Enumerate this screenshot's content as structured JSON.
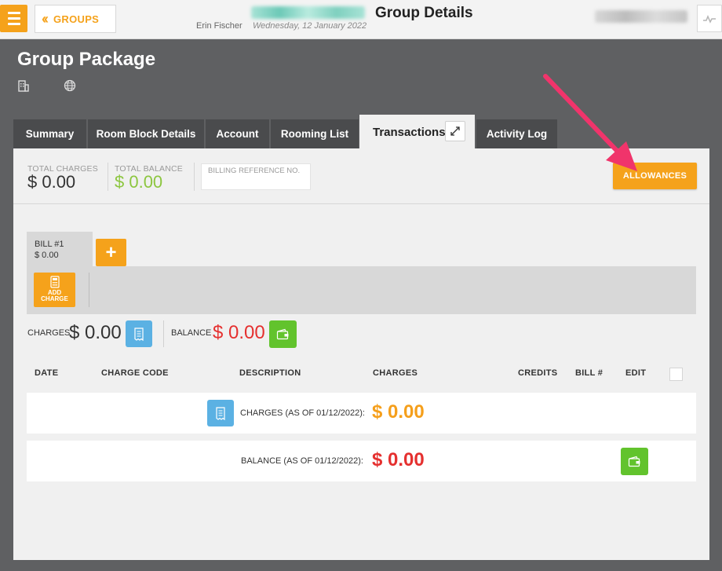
{
  "topbar": {
    "menu_icon": "hamburger-icon",
    "back_label": "GROUPS",
    "page_title": "Group Details",
    "user_name": "Erin Fischer",
    "date": "Wednesday, 12 January 2022",
    "activity_icon": "pulse-icon"
  },
  "header": {
    "title": "Group Package",
    "icons": [
      "building-icon",
      "globe-icon"
    ]
  },
  "tabs": [
    {
      "label": "Summary"
    },
    {
      "label": "Room Block Details"
    },
    {
      "label": "Account"
    },
    {
      "label": "Rooming List"
    },
    {
      "label": "Transactions",
      "active": true
    },
    {
      "label": "Activity Log"
    }
  ],
  "summary": {
    "total_charges_label": "TOTAL CHARGES",
    "total_charges_value": "$ 0.00",
    "total_balance_label": "TOTAL BALANCE",
    "total_balance_value": "$ 0.00",
    "billing_ref_placeholder": "BILLING REFERENCE NO.",
    "allowances_label": "ALLOWANCES"
  },
  "bill": {
    "name": "BILL #1",
    "amount": "$ 0.00",
    "add_bill_label": "+",
    "add_charge_label_1": "ADD",
    "add_charge_label_2": "CHARGE"
  },
  "totals": {
    "charges_label": "CHARGES",
    "charges_value": "$ 0.00",
    "balance_label": "BALANCE",
    "balance_value": "$ 0.00"
  },
  "table": {
    "headers": [
      "DATE",
      "CHARGE CODE",
      "DESCRIPTION",
      "CHARGES",
      "CREDITS",
      "BILL #",
      "EDIT"
    ],
    "charges_row_label": "CHARGES (AS OF 01/12/2022):",
    "charges_row_value": "$ 0.00",
    "balance_row_label": "BALANCE (AS OF 01/12/2022):",
    "balance_row_value": "$ 0.00"
  },
  "colors": {
    "accent": "#f5a21b",
    "positive": "#8cc63f",
    "negative": "#e5302f",
    "charges_orange": "#f59f1b",
    "info_blue": "#5bb1e3",
    "action_green": "#62c32d",
    "annotation_arrow": "#f0346b"
  }
}
